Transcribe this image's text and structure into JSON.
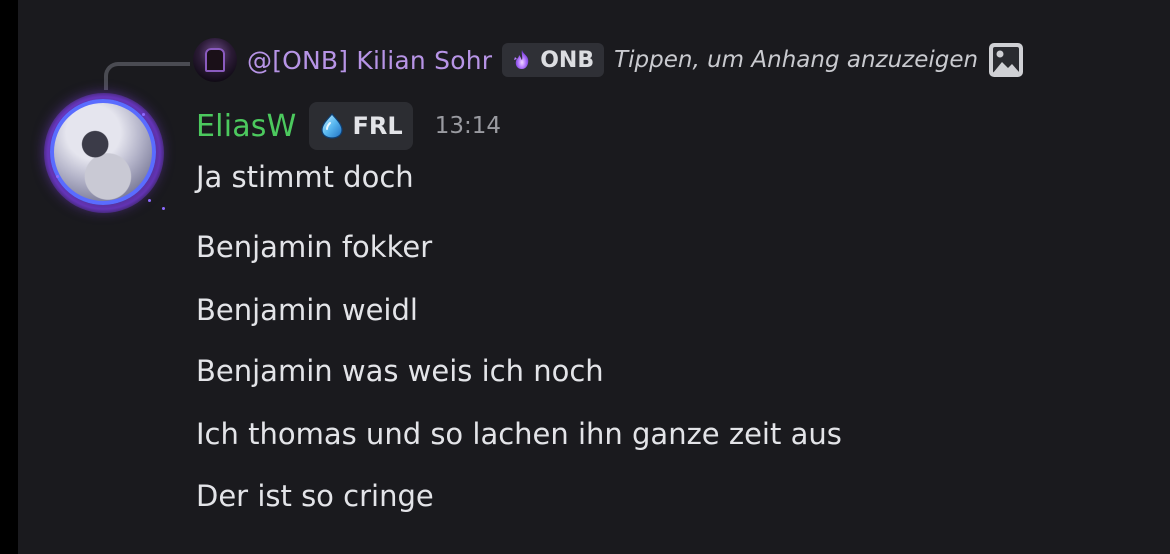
{
  "reply": {
    "author": "@[ONB] Kilian Sohr",
    "tag": "ONB",
    "content": "Tippen, um Anhang anzuzeigen",
    "tag_icon": "purple-flame-icon",
    "attachment_icon": "image-icon"
  },
  "message": {
    "username": "EliasW",
    "clan_tag": "FRL",
    "clan_icon": "blue-droplet-icon",
    "timestamp": "13:14",
    "lines": [
      "Ja stimmt doch",
      "Benjamin fokker",
      "Benjamin weidl",
      "Benjamin was weis ich noch",
      "Ich thomas und so lachen ihn ganze zeit aus",
      "Der ist so cringe"
    ]
  },
  "colors": {
    "background": "#1a1a1e",
    "username": "#4cc95e",
    "reply_author": "#b794e6",
    "text": "#e3e4e8",
    "muted": "#9a9ba1"
  }
}
